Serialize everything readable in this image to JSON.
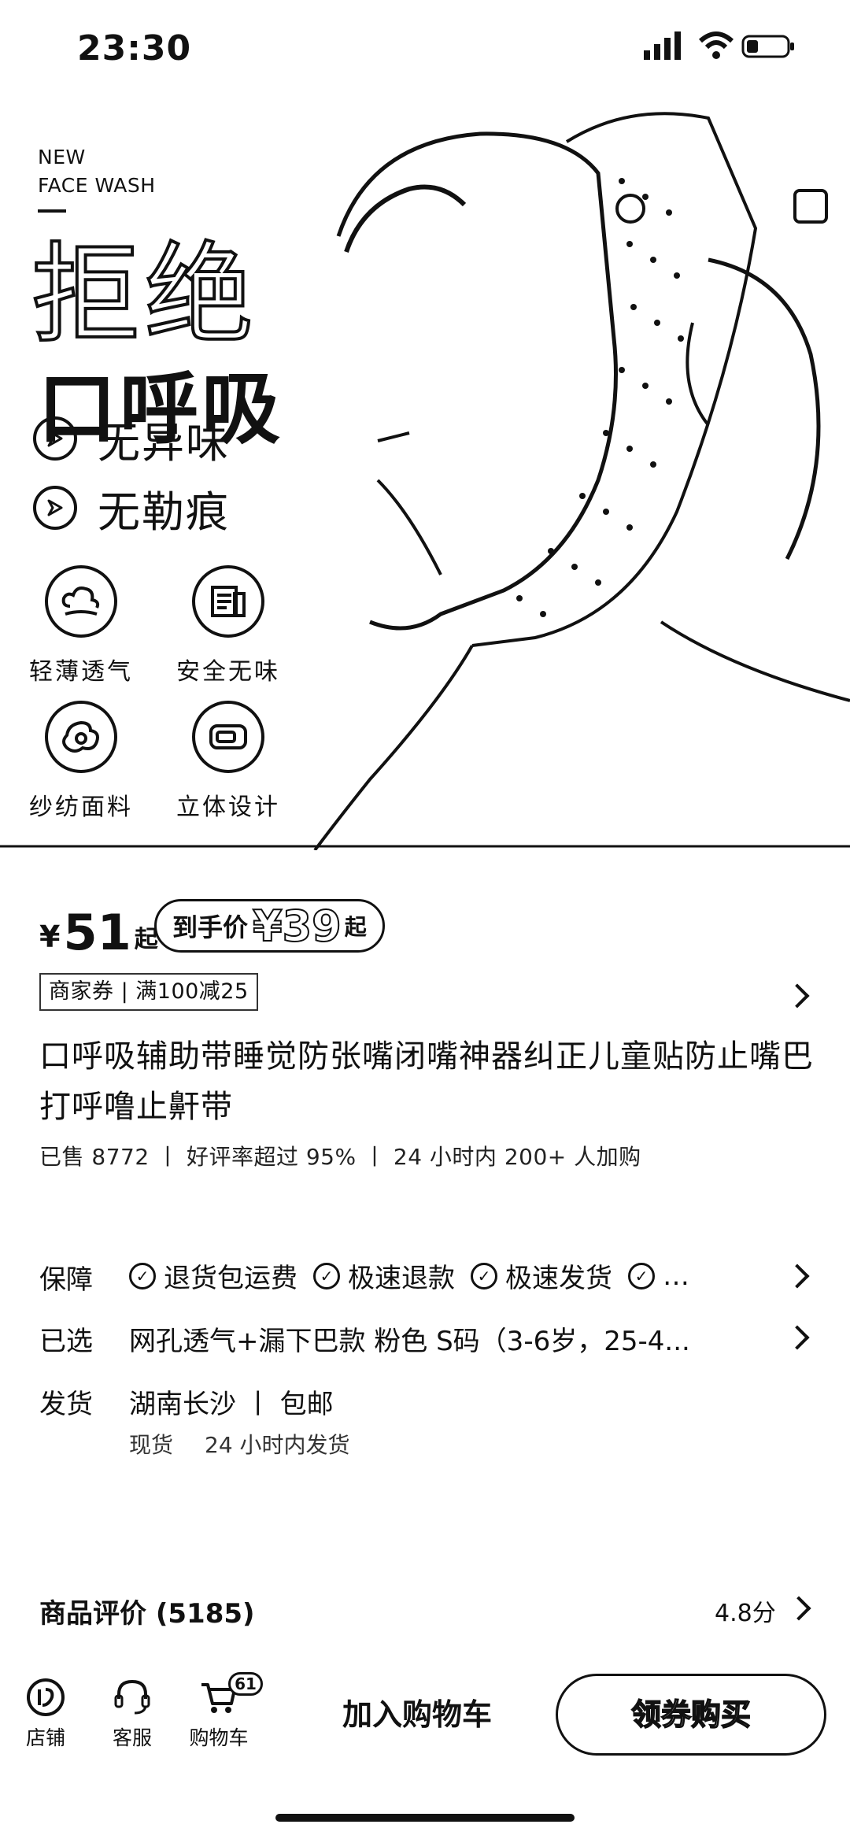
{
  "status": {
    "time": "23:30"
  },
  "hero": {
    "brand_line1": "NEW",
    "brand_line2": "FACE WASH",
    "title1": "拒绝",
    "title2": "口呼吸",
    "features": [
      "无异味",
      "无勒痕"
    ],
    "icons": [
      {
        "label": "轻薄透气",
        "icon": "cloud-wind-icon"
      },
      {
        "label": "安全无味",
        "icon": "document-icon"
      },
      {
        "label": "纱纺面料",
        "icon": "fabric-icon"
      },
      {
        "label": "立体设计",
        "icon": "3d-box-icon"
      }
    ]
  },
  "price": {
    "symbol": "¥",
    "value": "51",
    "suffix": "起",
    "final_label": "到手价",
    "final_value": "¥39",
    "final_suffix": "起",
    "coupon": "商家券 | 满100减25"
  },
  "product": {
    "title": "口呼吸辅助带睡觉防张嘴闭嘴神器纠正儿童贴防止嘴巴打呼噜止鼾带",
    "stats": "已售 8772  丨  好评率超过 95%  丨  24 小时内 200+ 人加购"
  },
  "guarantee": {
    "label": "保障",
    "items": [
      "退货包运费",
      "极速退款",
      "极速发货",
      "…"
    ]
  },
  "selected": {
    "label": "已选",
    "value": "网孔透气+漏下巴款 粉色 S码（3-6岁，25-4..."
  },
  "shipping": {
    "label": "发货",
    "value": "湖南长沙 丨 包邮",
    "sub1": "现货",
    "sub2": "24 小时内发货"
  },
  "reviews": {
    "label": "商品评价 (5185)",
    "score": "4.8分"
  },
  "tabbar": {
    "shop": "店铺",
    "service": "客服",
    "cart": "购物车",
    "cart_badge": "61",
    "add_cart": "加入购物车",
    "buy": "领券购买"
  }
}
